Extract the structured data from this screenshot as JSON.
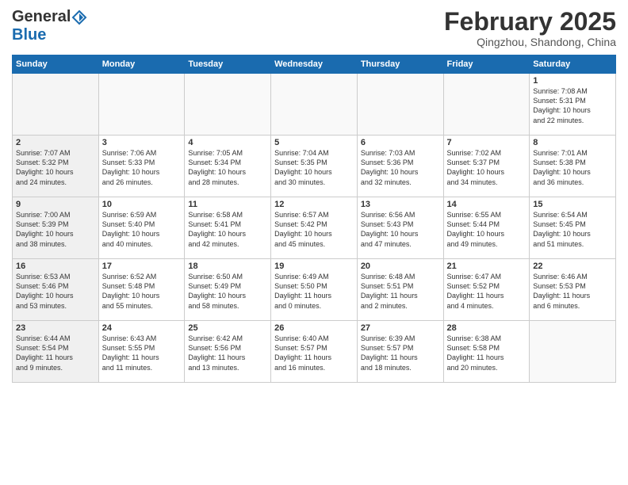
{
  "header": {
    "logo_general": "General",
    "logo_blue": "Blue",
    "month_title": "February 2025",
    "location": "Qingzhou, Shandong, China"
  },
  "weekdays": [
    "Sunday",
    "Monday",
    "Tuesday",
    "Wednesday",
    "Thursday",
    "Friday",
    "Saturday"
  ],
  "weeks": [
    [
      {
        "day": "",
        "info": ""
      },
      {
        "day": "",
        "info": ""
      },
      {
        "day": "",
        "info": ""
      },
      {
        "day": "",
        "info": ""
      },
      {
        "day": "",
        "info": ""
      },
      {
        "day": "",
        "info": ""
      },
      {
        "day": "1",
        "info": "Sunrise: 7:08 AM\nSunset: 5:31 PM\nDaylight: 10 hours\nand 22 minutes."
      }
    ],
    [
      {
        "day": "2",
        "info": "Sunrise: 7:07 AM\nSunset: 5:32 PM\nDaylight: 10 hours\nand 24 minutes."
      },
      {
        "day": "3",
        "info": "Sunrise: 7:06 AM\nSunset: 5:33 PM\nDaylight: 10 hours\nand 26 minutes."
      },
      {
        "day": "4",
        "info": "Sunrise: 7:05 AM\nSunset: 5:34 PM\nDaylight: 10 hours\nand 28 minutes."
      },
      {
        "day": "5",
        "info": "Sunrise: 7:04 AM\nSunset: 5:35 PM\nDaylight: 10 hours\nand 30 minutes."
      },
      {
        "day": "6",
        "info": "Sunrise: 7:03 AM\nSunset: 5:36 PM\nDaylight: 10 hours\nand 32 minutes."
      },
      {
        "day": "7",
        "info": "Sunrise: 7:02 AM\nSunset: 5:37 PM\nDaylight: 10 hours\nand 34 minutes."
      },
      {
        "day": "8",
        "info": "Sunrise: 7:01 AM\nSunset: 5:38 PM\nDaylight: 10 hours\nand 36 minutes."
      }
    ],
    [
      {
        "day": "9",
        "info": "Sunrise: 7:00 AM\nSunset: 5:39 PM\nDaylight: 10 hours\nand 38 minutes."
      },
      {
        "day": "10",
        "info": "Sunrise: 6:59 AM\nSunset: 5:40 PM\nDaylight: 10 hours\nand 40 minutes."
      },
      {
        "day": "11",
        "info": "Sunrise: 6:58 AM\nSunset: 5:41 PM\nDaylight: 10 hours\nand 42 minutes."
      },
      {
        "day": "12",
        "info": "Sunrise: 6:57 AM\nSunset: 5:42 PM\nDaylight: 10 hours\nand 45 minutes."
      },
      {
        "day": "13",
        "info": "Sunrise: 6:56 AM\nSunset: 5:43 PM\nDaylight: 10 hours\nand 47 minutes."
      },
      {
        "day": "14",
        "info": "Sunrise: 6:55 AM\nSunset: 5:44 PM\nDaylight: 10 hours\nand 49 minutes."
      },
      {
        "day": "15",
        "info": "Sunrise: 6:54 AM\nSunset: 5:45 PM\nDaylight: 10 hours\nand 51 minutes."
      }
    ],
    [
      {
        "day": "16",
        "info": "Sunrise: 6:53 AM\nSunset: 5:46 PM\nDaylight: 10 hours\nand 53 minutes."
      },
      {
        "day": "17",
        "info": "Sunrise: 6:52 AM\nSunset: 5:48 PM\nDaylight: 10 hours\nand 55 minutes."
      },
      {
        "day": "18",
        "info": "Sunrise: 6:50 AM\nSunset: 5:49 PM\nDaylight: 10 hours\nand 58 minutes."
      },
      {
        "day": "19",
        "info": "Sunrise: 6:49 AM\nSunset: 5:50 PM\nDaylight: 11 hours\nand 0 minutes."
      },
      {
        "day": "20",
        "info": "Sunrise: 6:48 AM\nSunset: 5:51 PM\nDaylight: 11 hours\nand 2 minutes."
      },
      {
        "day": "21",
        "info": "Sunrise: 6:47 AM\nSunset: 5:52 PM\nDaylight: 11 hours\nand 4 minutes."
      },
      {
        "day": "22",
        "info": "Sunrise: 6:46 AM\nSunset: 5:53 PM\nDaylight: 11 hours\nand 6 minutes."
      }
    ],
    [
      {
        "day": "23",
        "info": "Sunrise: 6:44 AM\nSunset: 5:54 PM\nDaylight: 11 hours\nand 9 minutes."
      },
      {
        "day": "24",
        "info": "Sunrise: 6:43 AM\nSunset: 5:55 PM\nDaylight: 11 hours\nand 11 minutes."
      },
      {
        "day": "25",
        "info": "Sunrise: 6:42 AM\nSunset: 5:56 PM\nDaylight: 11 hours\nand 13 minutes."
      },
      {
        "day": "26",
        "info": "Sunrise: 6:40 AM\nSunset: 5:57 PM\nDaylight: 11 hours\nand 16 minutes."
      },
      {
        "day": "27",
        "info": "Sunrise: 6:39 AM\nSunset: 5:57 PM\nDaylight: 11 hours\nand 18 minutes."
      },
      {
        "day": "28",
        "info": "Sunrise: 6:38 AM\nSunset: 5:58 PM\nDaylight: 11 hours\nand 20 minutes."
      },
      {
        "day": "",
        "info": ""
      }
    ]
  ]
}
